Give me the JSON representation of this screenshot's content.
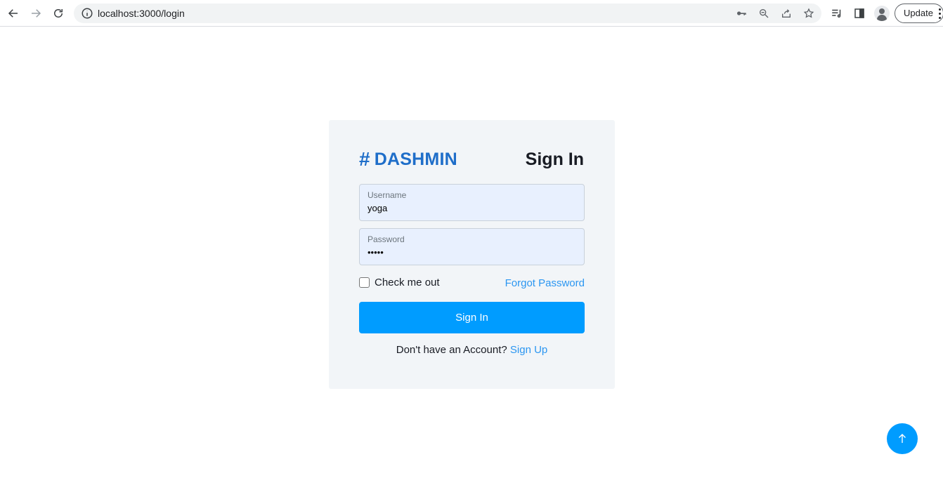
{
  "browser": {
    "url": "localhost:3000/login",
    "update_label": "Update",
    "icons": [
      "back-arrow-icon",
      "forward-arrow-icon",
      "reload-icon",
      "info-icon",
      "key-icon",
      "zoom-out-icon",
      "share-icon",
      "star-icon",
      "media-icon",
      "side-panel-icon",
      "profile-icon",
      "more-icon"
    ]
  },
  "login": {
    "brand": "DASHMIN",
    "brand_icon": "hash-icon",
    "title": "Sign In",
    "username_label": "Username",
    "username_value": "yoga",
    "password_label": "Password",
    "password_value": "•••••",
    "remember_label": "Check me out",
    "forgot_label": "Forgot Password",
    "submit_label": "Sign In",
    "signup_prompt": "Don't have an Account?",
    "signup_link": "Sign Up"
  },
  "colors": {
    "brand": "#1f6ec9",
    "primary": "#009cff",
    "link": "#2b96f1",
    "card_bg": "#f2f5f8",
    "input_bg": "#e8f0fe"
  },
  "back_to_top_icon": "arrow-up-icon"
}
